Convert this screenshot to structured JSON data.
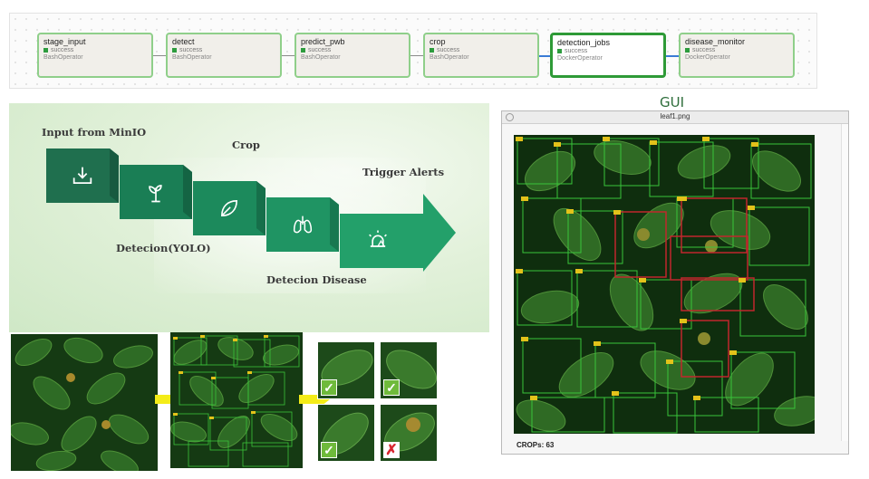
{
  "dag": {
    "tasks": [
      {
        "name": "stage_input",
        "status": "success",
        "operator": "BashOperator"
      },
      {
        "name": "detect",
        "status": "success",
        "operator": "BashOperator"
      },
      {
        "name": "predict_pwb",
        "status": "success",
        "operator": "BashOperator"
      },
      {
        "name": "crop",
        "status": "success",
        "operator": "BashOperator"
      },
      {
        "name": "detection_jobs",
        "status": "success",
        "operator": "DockerOperator"
      },
      {
        "name": "disease_monitor",
        "status": "success",
        "operator": "DockerOperator"
      }
    ],
    "status_color": "#2d9c3e"
  },
  "pipeline": {
    "labels": {
      "input": "Input from MinIO",
      "detection": "Detecion(YOLO)",
      "crop": "Crop",
      "disease": "Detecion Disease",
      "alerts": "Trigger Alerts"
    },
    "icons": [
      "download-icon",
      "plant-icon",
      "leaf-icon",
      "lungs-icon",
      "alarm-icon"
    ],
    "colors": [
      "#1f6f4e",
      "#1a7e55",
      "#1c8a5c",
      "#1f9463",
      "#23a06a"
    ]
  },
  "gui": {
    "heading": "GUI",
    "window_title": "leaf1.png",
    "crops_label": "CROPs: 63"
  },
  "crops": {
    "results": [
      "ok",
      "ok",
      "ok",
      "reject"
    ],
    "ok_symbol": "✓",
    "reject_symbol": "✗"
  }
}
